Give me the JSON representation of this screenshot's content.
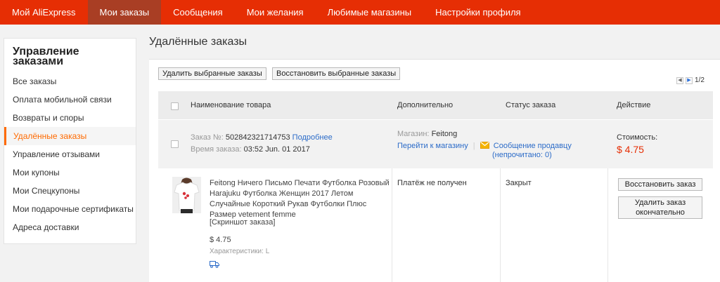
{
  "topnav": {
    "items": [
      "Мой AliExpress",
      "Мои заказы",
      "Сообщения",
      "Мои желания",
      "Любимые магазины",
      "Настройки профиля"
    ],
    "active_index": 1
  },
  "sidebar": {
    "title": "Управление заказами",
    "items": [
      "Все заказы",
      "Оплата мобильной связи",
      "Возвраты и споры",
      "Удалённые заказы",
      "Управление отзывами",
      "Мои купоны",
      "Мои Спецкупоны",
      "Мои подарочные сертификаты",
      "Адреса доставки"
    ],
    "active_index": 3
  },
  "page": {
    "title": "Удалённые заказы",
    "delete_selected_label": "Удалить выбранные заказы",
    "restore_selected_label": "Восстановить выбранные заказы",
    "pagination": "1/2"
  },
  "table": {
    "headers": {
      "product": "Наименование товара",
      "additional": "Дополнительно",
      "status": "Статус заказа",
      "action": "Действие"
    }
  },
  "order": {
    "number_label": "Заказ №:",
    "number": "502842321714753",
    "details_link": "Подробнее",
    "time_label": "Время заказа:",
    "time": "03:52 Jun. 01 2017",
    "store_label": "Магазин:",
    "store_name": "Feitong",
    "go_to_store": "Перейти к магазину",
    "separator": "|",
    "message_seller": "Сообщение продавцу",
    "unread_open": "(непрочитано:",
    "unread_count": "0",
    "unread_close": ")",
    "cost_label": "Стоимость:",
    "cost": "$ 4.75"
  },
  "product": {
    "name": "Feitong Ничего Письмо Печати Футболка Розовый Harajuku Футболка Женщин 2017 Летом Случайные Короткий Рукав Футболки Плюс Размер vetement femme",
    "snapshot": "[Скриншот заказа]",
    "price": "$ 4.75",
    "specs": "Характеристики: L",
    "payment_status": "Платёж не получен",
    "order_status": "Закрыт",
    "restore_label": "Восстановить заказ",
    "delete_forever_label": "Удалить заказ окончательно"
  },
  "colors": {
    "nav_bg": "#e62e04",
    "nav_active": "#a93e24",
    "accent_orange": "#ff6a00",
    "link_blue": "#2b6bc8",
    "price_red": "#e62e04"
  }
}
